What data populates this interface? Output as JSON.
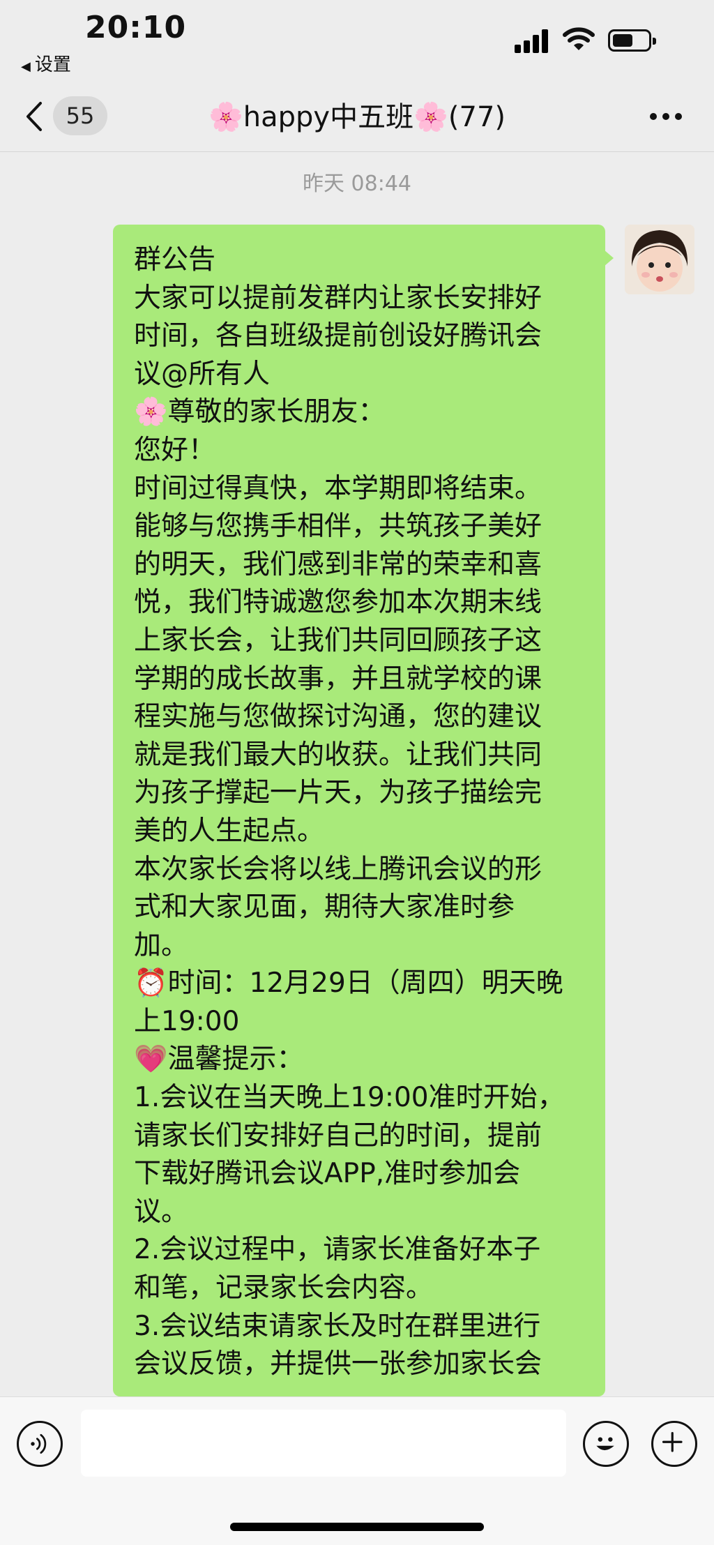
{
  "status_bar": {
    "time": "20:10",
    "back_app": "设置"
  },
  "nav": {
    "unread_count": "55",
    "title": "🌸happy中五班🌸(77)"
  },
  "chat": {
    "timestamp": "昨天 08:44",
    "message_lines": [
      "群公告",
      "大家可以提前发群内让家长安排好",
      "时间，各自班级提前创设好腾讯会",
      "议@所有人",
      "🌸尊敬的家长朋友：",
      "您好！",
      "时间过得真快，本学期即将结束。",
      "能够与您携手相伴，共筑孩子美好",
      "的明天，我们感到非常的荣幸和喜",
      "悦，我们特诚邀您参加本次期末线",
      "上家长会，让我们共同回顾孩子这",
      "学期的成长故事，并且就学校的课",
      "程实施与您做探讨沟通，您的建议",
      "就是我们最大的收获。让我们共同",
      "为孩子撑起一片天，为孩子描绘完",
      "美的人生起点。",
      "本次家长会将以线上腾讯会议的形",
      "式和大家见面，期待大家准时参",
      "加。",
      "⏰时间：12月29日（周四）明天晚",
      "上19:00",
      "💗温馨提示：",
      "1.会议在当天晚上19:00准时开始，",
      "请家长们安排好自己的时间，提前",
      "下载好腾讯会议APP,准时参加会",
      "议。",
      "2.会议过程中，请家长准备好本子",
      "和笔，记录家长会内容。",
      "3.会议结束请家长及时在群里进行",
      "会议反馈，并提供一张参加家长会"
    ]
  },
  "input_bar": {
    "placeholder": ""
  },
  "colors": {
    "bubble": "#a9ea7a",
    "background": "#ededed",
    "badge": "#d9d9d9"
  }
}
